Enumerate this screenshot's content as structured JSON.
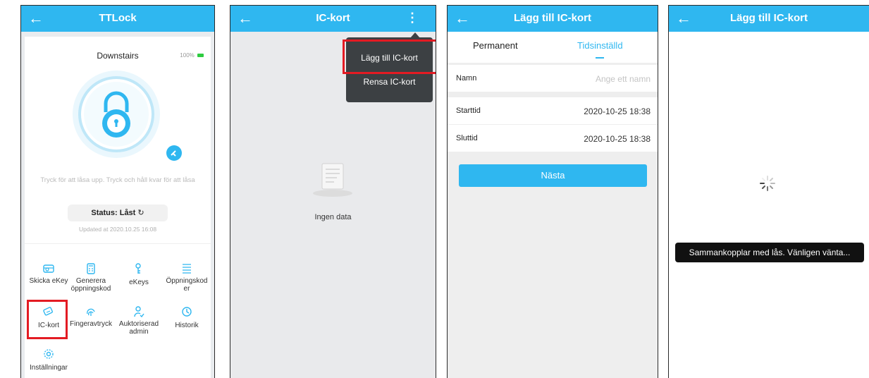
{
  "screen1": {
    "title": "TTLock",
    "back_icon": "arrow-left-icon",
    "lock_name": "Downstairs",
    "battery": "100%",
    "hint": "Tryck för att låsa upp. Tryck och håll kvar för att låsa",
    "status_label": "Status:",
    "status_value": "Låst",
    "updated": "Updated at 2020.10.25 16:08",
    "grid": [
      {
        "label": "Skicka eKey",
        "icon": "ekey-send-icon"
      },
      {
        "label": "Generera öppningskod",
        "icon": "calculator-icon"
      },
      {
        "label": "eKeys",
        "icon": "key-user-icon"
      },
      {
        "label": "Öppningskoder",
        "icon": "code-list-icon"
      },
      {
        "label": "IC-kort",
        "icon": "ic-card-icon"
      },
      {
        "label": "Fingeravtryck",
        "icon": "fingerprint-icon"
      },
      {
        "label": "Auktoriserad admin",
        "icon": "admin-user-icon"
      },
      {
        "label": "Historik",
        "icon": "history-icon"
      },
      {
        "label": "Inställningar",
        "icon": "settings-gear-icon"
      }
    ],
    "accent": "#2fb7f0",
    "highlight": "#e31b23"
  },
  "screen2": {
    "title": "IC-kort",
    "empty_text": "Ingen data",
    "menu": [
      "Lägg till IC-kort",
      "Rensa IC-kort"
    ]
  },
  "screen3": {
    "title": "Lägg till IC-kort",
    "tabs": [
      "Permanent",
      "Tidsinställd"
    ],
    "name_label": "Namn",
    "name_placeholder": "Ange ett namn",
    "start_label": "Starttid",
    "start_value": "2020-10-25 18:38",
    "end_label": "Sluttid",
    "end_value": "2020-10-25 18:38",
    "next_button": "Nästa"
  },
  "screen4": {
    "title": "Lägg till IC-kort",
    "toast": "Sammankopplar med lås. Vänligen vänta..."
  }
}
